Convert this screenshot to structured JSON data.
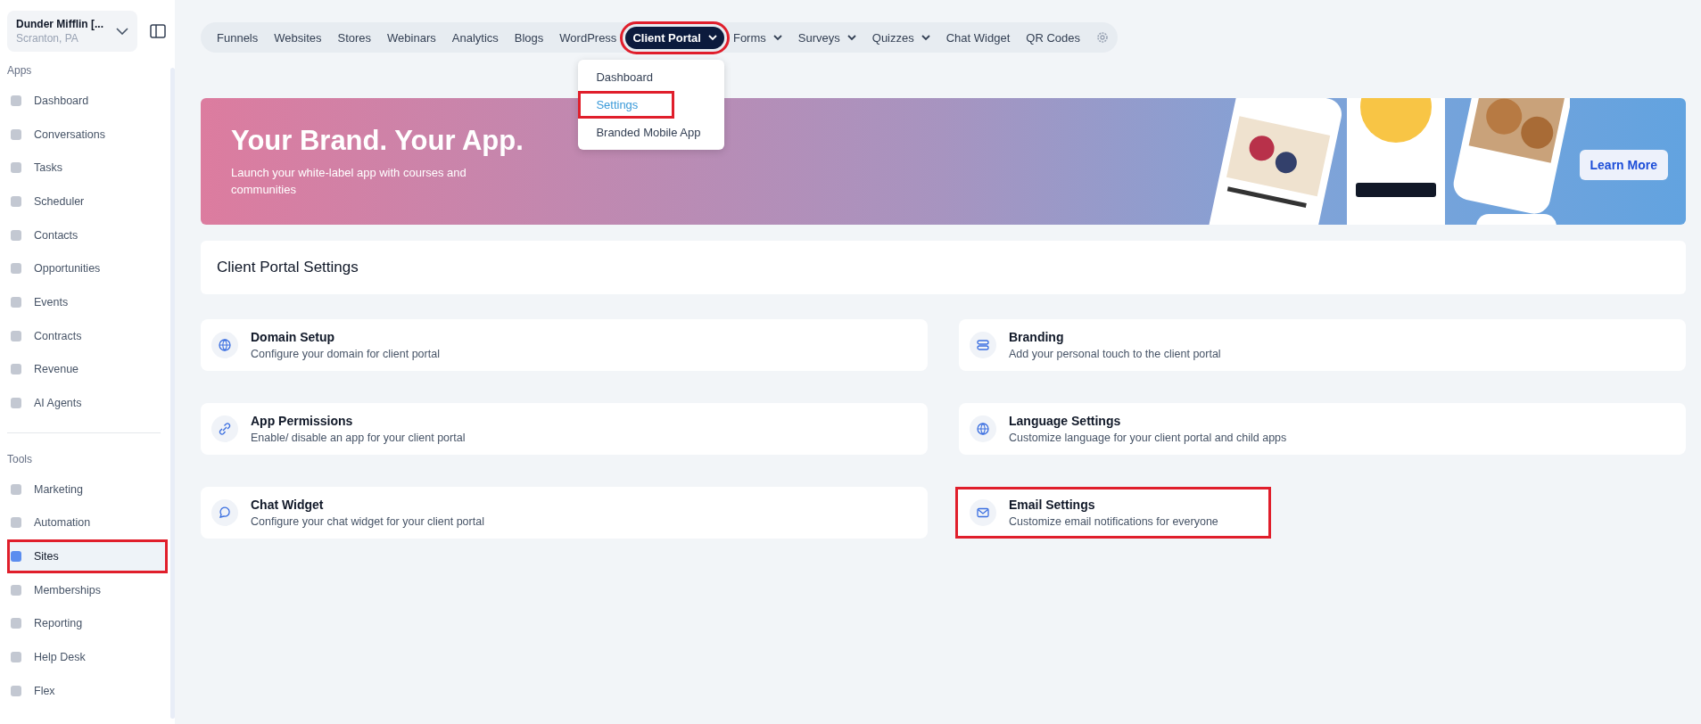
{
  "account": {
    "name": "Dunder Mifflin [...",
    "location": "Scranton, PA"
  },
  "sidebar": {
    "sections": [
      {
        "title": "Apps",
        "items": [
          {
            "label": "Dashboard",
            "selected": false,
            "highlighted": false
          },
          {
            "label": "Conversations",
            "selected": false,
            "highlighted": false
          },
          {
            "label": "Tasks",
            "selected": false,
            "highlighted": false
          },
          {
            "label": "Scheduler",
            "selected": false,
            "highlighted": false
          },
          {
            "label": "Contacts",
            "selected": false,
            "highlighted": false
          },
          {
            "label": "Opportunities",
            "selected": false,
            "highlighted": false
          },
          {
            "label": "Events",
            "selected": false,
            "highlighted": false
          },
          {
            "label": "Contracts",
            "selected": false,
            "highlighted": false
          },
          {
            "label": "Revenue",
            "selected": false,
            "highlighted": false
          },
          {
            "label": "AI Agents",
            "selected": false,
            "highlighted": false
          }
        ]
      },
      {
        "title": "Tools",
        "items": [
          {
            "label": "Marketing",
            "selected": false,
            "highlighted": false
          },
          {
            "label": "Automation",
            "selected": false,
            "highlighted": false
          },
          {
            "label": "Sites",
            "selected": true,
            "highlighted": true
          },
          {
            "label": "Memberships",
            "selected": false,
            "highlighted": false
          },
          {
            "label": "Reporting",
            "selected": false,
            "highlighted": false
          },
          {
            "label": "Help Desk",
            "selected": false,
            "highlighted": false
          },
          {
            "label": "Flex",
            "selected": false,
            "highlighted": false
          }
        ]
      }
    ]
  },
  "tabs": [
    {
      "label": "Funnels",
      "selected": false,
      "dropdown": false,
      "highlighted": false
    },
    {
      "label": "Websites",
      "selected": false,
      "dropdown": false,
      "highlighted": false
    },
    {
      "label": "Stores",
      "selected": false,
      "dropdown": false,
      "highlighted": false
    },
    {
      "label": "Webinars",
      "selected": false,
      "dropdown": false,
      "highlighted": false
    },
    {
      "label": "Analytics",
      "selected": false,
      "dropdown": false,
      "highlighted": false
    },
    {
      "label": "Blogs",
      "selected": false,
      "dropdown": false,
      "highlighted": false
    },
    {
      "label": "WordPress",
      "selected": false,
      "dropdown": false,
      "highlighted": false
    },
    {
      "label": "Client Portal",
      "selected": true,
      "dropdown": true,
      "highlighted": true,
      "menu": [
        {
          "label": "Dashboard",
          "selected": false,
          "highlighted": false
        },
        {
          "label": "Settings",
          "selected": true,
          "highlighted": true
        },
        {
          "label": "Branded Mobile App",
          "selected": false,
          "highlighted": false
        }
      ]
    },
    {
      "label": "Forms",
      "selected": false,
      "dropdown": true,
      "highlighted": false
    },
    {
      "label": "Surveys",
      "selected": false,
      "dropdown": true,
      "highlighted": false
    },
    {
      "label": "Quizzes",
      "selected": false,
      "dropdown": true,
      "highlighted": false
    },
    {
      "label": "Chat Widget",
      "selected": false,
      "dropdown": false,
      "highlighted": false
    },
    {
      "label": "QR Codes",
      "selected": false,
      "dropdown": false,
      "highlighted": false
    }
  ],
  "banner": {
    "title": "Your Brand. Your App.",
    "subtitle": "Launch your white-label app with courses and communities",
    "button": "Learn More"
  },
  "page_title": "Client Portal Settings",
  "cards": [
    {
      "title": "Domain Setup",
      "description": "Configure your domain for client portal",
      "highlighted": false
    },
    {
      "title": "Branding",
      "description": "Add your personal touch to the client portal",
      "highlighted": false
    },
    {
      "title": "App Permissions",
      "description": "Enable/ disable an app for your client portal",
      "highlighted": false
    },
    {
      "title": "Language Settings",
      "description": "Customize language for your client portal and child apps",
      "highlighted": false
    },
    {
      "title": "Chat Widget",
      "description": "Configure your chat widget for your client portal",
      "highlighted": false
    },
    {
      "title": "Email Settings",
      "description": "Customize email notifications for everyone",
      "highlighted": true
    }
  ]
}
